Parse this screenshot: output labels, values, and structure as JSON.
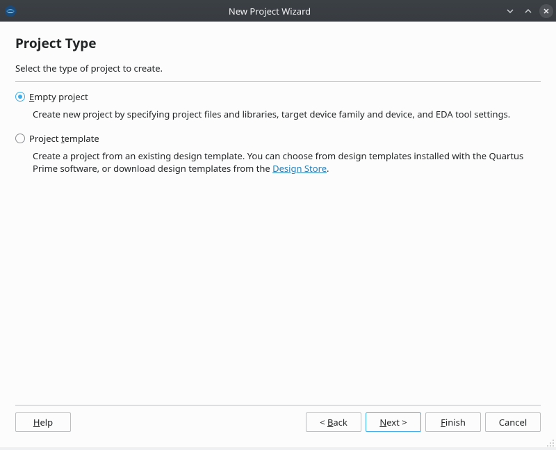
{
  "window": {
    "title": "New Project Wizard"
  },
  "page": {
    "title": "Project Type",
    "subtitle": "Select the type of project to create."
  },
  "options": {
    "empty": {
      "checked": true,
      "label_prefix": "E",
      "label_rest": "mpty project",
      "description": "Create new project by specifying project files and libraries, target device family and device, and EDA tool settings."
    },
    "template": {
      "checked": false,
      "label_prefix": "Project ",
      "label_underline": "t",
      "label_rest": "emplate",
      "desc_before": "Create a project from an existing design template. You can choose from design templates installed with the Quartus Prime software, or download design templates from the ",
      "link_text": "Design Store",
      "desc_after": "."
    }
  },
  "buttons": {
    "help_ul": "H",
    "help_rest": "elp",
    "back_prefix": "< ",
    "back_ul": "B",
    "back_rest": "ack",
    "next_ul": "N",
    "next_rest": "ext >",
    "finish_ul": "F",
    "finish_rest": "inish",
    "cancel": "Cancel"
  }
}
